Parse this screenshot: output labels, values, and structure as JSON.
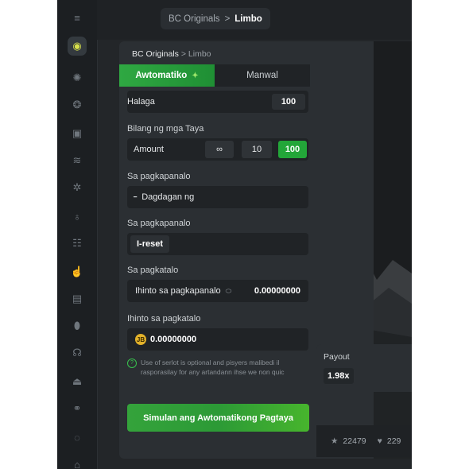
{
  "breadcrumb_top": {
    "parent": "BC Originals",
    "separator": ">",
    "current": "Limbo"
  },
  "panel": {
    "breadcrumb": {
      "parent": "BC Originals",
      "separator": ">",
      "current": "Limbo"
    },
    "tabs": [
      {
        "label": "Awtomatiko",
        "active": true
      },
      {
        "label": "Manwal",
        "active": false
      }
    ],
    "halaga": {
      "label": "Halaga",
      "value": "100"
    },
    "bet_count": {
      "label": "Bilang ng mga Taya",
      "field_label": "Amount",
      "options": [
        "∞",
        "10",
        "100"
      ],
      "selected": "100"
    },
    "on_win_1": {
      "label": "Sa pagkapanalo",
      "value": "Dagdagan ng",
      "icon": "bar-icon"
    },
    "on_win_2": {
      "label": "Sa pagkapanalo",
      "value": "I-reset"
    },
    "on_loss": {
      "label": "Sa pagkatalo",
      "stop_label": "Ihinto sa pagkapanalo",
      "value": "0.00000000"
    },
    "stop_on_loss": {
      "label": "Ihinto sa pagkatalo",
      "value": "0.00000000",
      "coin_symbol": "JB"
    },
    "note": "Use of serlot is optional and pisyers malibedi il rasporasilay for any artandann ihse we non quic",
    "start_button": "Simulan ang Awtomatikong Pagtaya"
  },
  "payout": {
    "label": "Payout",
    "value": "1.98x"
  },
  "stats": {
    "favorites": "22479",
    "likes": "229"
  },
  "colors": {
    "accent_green": "#23a639",
    "background": "#232629",
    "panel": "#2b2f33"
  }
}
